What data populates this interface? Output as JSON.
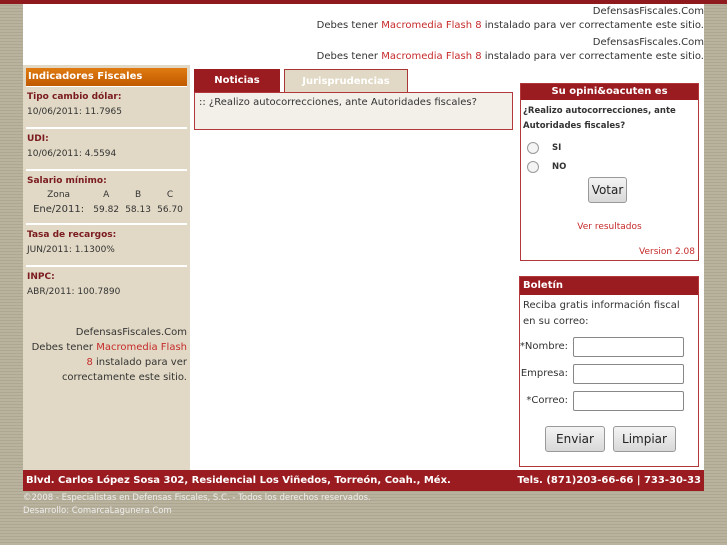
{
  "flash": {
    "site": "DefensasFiscales.Com",
    "pre": "Debes tener ",
    "link": "Macromedia Flash 8",
    "post": " instalado para ver correctamente este sitio."
  },
  "left": {
    "title": "Indicadores Fiscales",
    "dolar": {
      "label": "Tipo cambio dólar:",
      "value": "10/06/2011:  11.7965"
    },
    "udi": {
      "label": "UDI:",
      "value": "10/06/2011:  4.5594"
    },
    "salario": {
      "label": "Salario mínimo:",
      "headers": [
        "Zona",
        "A",
        "B",
        "C"
      ],
      "row": [
        "Ene/2011:",
        "59.82",
        "58.13",
        "56.70"
      ]
    },
    "recargos": {
      "label": "Tasa de recargos:",
      "value": "JUN/2011:  1.1300%"
    },
    "inpc": {
      "label": "INPC:",
      "value": "ABR/2011:  100.7890"
    },
    "flash": {
      "site": "DefensasFiscales.Com",
      "pre": "Debes tener ",
      "link": "Macromedia Flash 8",
      "post": " instalado para ver correctamente este sitio."
    }
  },
  "tabs": [
    "Noticias",
    "Jurisprudencias"
  ],
  "news": [
    ":: ¿Realizo autocorrecciones, ante Autoridades fiscales?"
  ],
  "poll": {
    "title": "Su opini&oacuten es importante",
    "question": "¿Realizo autocorrecciones, ante Autoridades fiscales?",
    "options": [
      "SI",
      "NO"
    ],
    "vote": "Votar",
    "results": "Ver resultados",
    "version": "Version 2.08"
  },
  "boletin": {
    "title": "Boletín",
    "text": "Reciba gratis información fiscal en su correo:",
    "fields": [
      "*Nombre:",
      "Empresa:",
      "*Correo:"
    ],
    "send": "Enviar",
    "clear": "Limpiar"
  },
  "footer": {
    "address": "Blvd. Carlos López Sosa 302, Residencial Los Viñedos, Torreón, Coah., Méx.",
    "phones": "Tels. (871)203-66-66 | 733-30-33",
    "copyright": "©2008 - Especialistas en Defensas Fiscales, S.C. - Todos los derechos reservados.",
    "dev": "Desarrollo: ComarcaLagunera.Com"
  }
}
